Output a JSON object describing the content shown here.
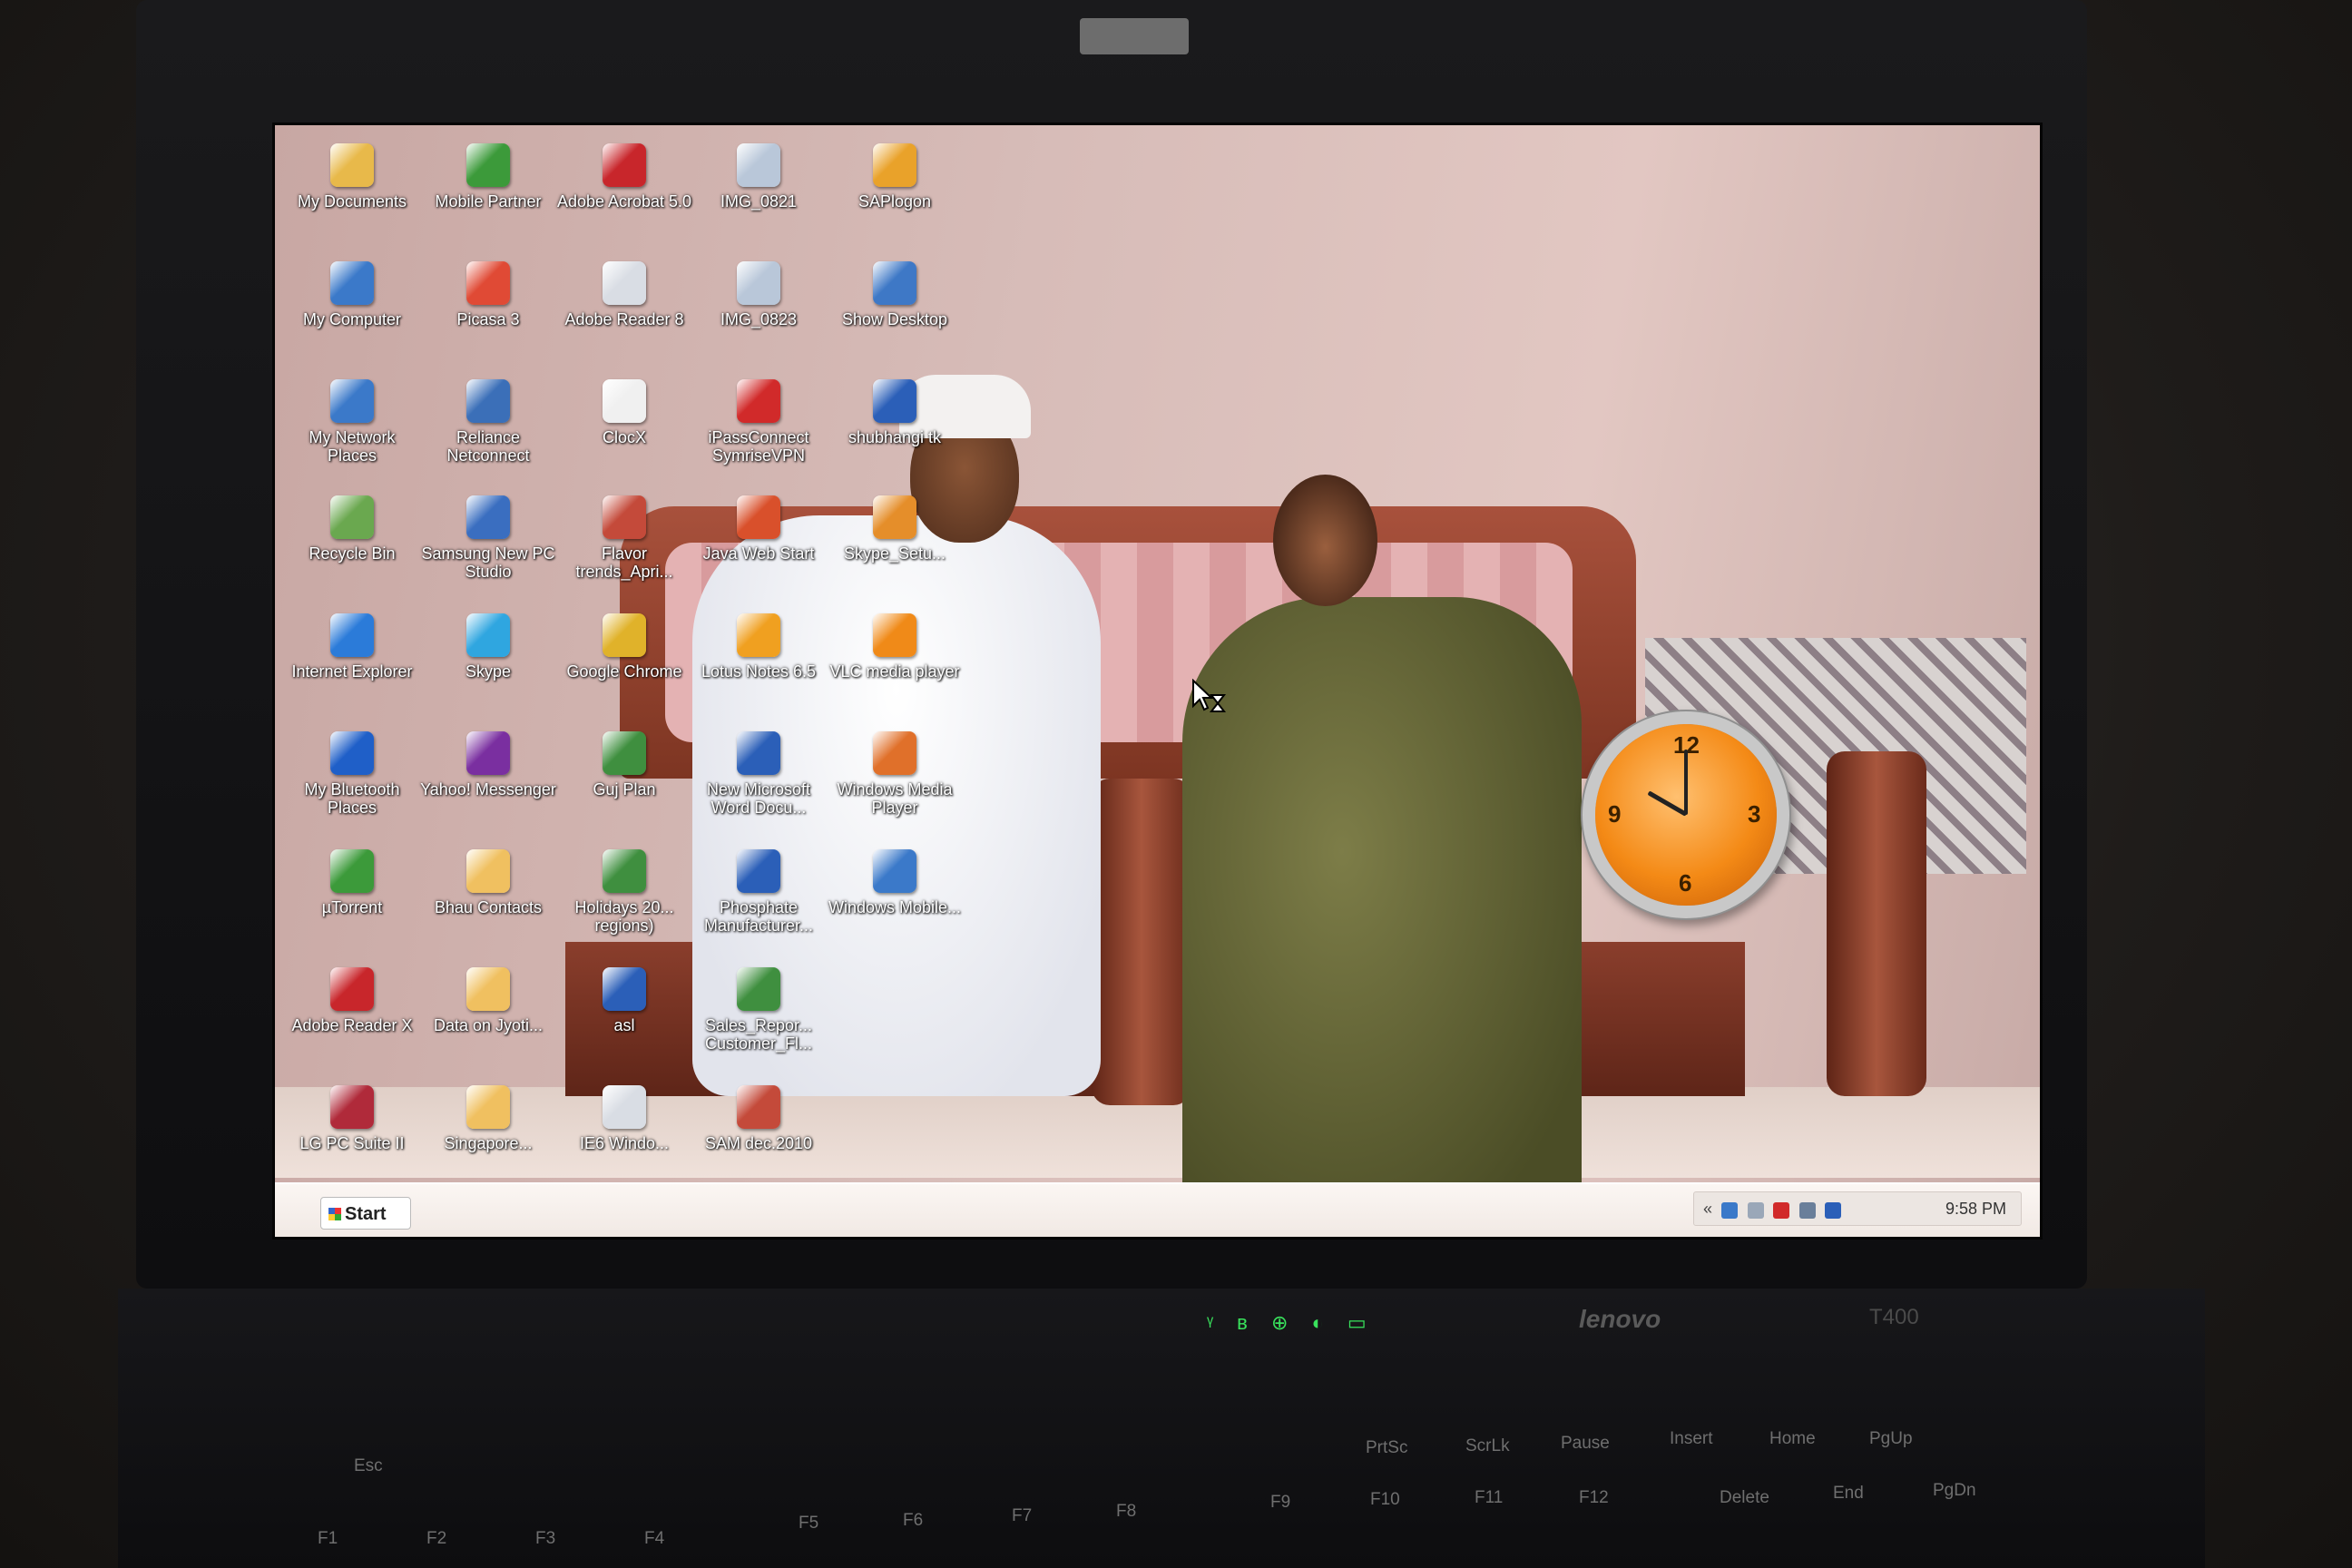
{
  "desktop": {
    "icons": [
      {
        "label": "My Documents",
        "color": "#e8b94a"
      },
      {
        "label": "Mobile Partner",
        "color": "#3c9a3a"
      },
      {
        "label": "Adobe Acrobat 5.0",
        "color": "#c8262b"
      },
      {
        "label": "IMG_0821",
        "color": "#b9c7d9"
      },
      {
        "label": "SAPlogon",
        "color": "#e9a22a"
      },
      {
        "label": "My Computer",
        "color": "#3b79c9"
      },
      {
        "label": "Picasa 3",
        "color": "#e04a35"
      },
      {
        "label": "Adobe Reader 8",
        "color": "#d9dde4"
      },
      {
        "label": "IMG_0823",
        "color": "#b9c7d9"
      },
      {
        "label": "Show Desktop",
        "color": "#3e78c6"
      },
      {
        "label": "My Network Places",
        "color": "#3b79c9"
      },
      {
        "label": "Reliance Netconnect",
        "color": "#3b6fb8"
      },
      {
        "label": "ClocX",
        "color": "#f0f0f0"
      },
      {
        "label": "iPassConnect SymriseVPN",
        "color": "#d12a2a"
      },
      {
        "label": "shubhangi tk",
        "color": "#2b5fb8"
      },
      {
        "label": "Recycle Bin",
        "color": "#6aa84f"
      },
      {
        "label": "Samsung New PC Studio",
        "color": "#3a6ec0"
      },
      {
        "label": "Flavor trends_Apri...",
        "color": "#c44a3a"
      },
      {
        "label": "Java Web Start",
        "color": "#d9502b"
      },
      {
        "label": "Skype_Setu...",
        "color": "#e58e2a"
      },
      {
        "label": "Internet Explorer",
        "color": "#2b7bd9"
      },
      {
        "label": "Skype",
        "color": "#2fa6e0"
      },
      {
        "label": "Google Chrome",
        "color": "#e0b22a"
      },
      {
        "label": "Lotus Notes 6.5",
        "color": "#f0a020"
      },
      {
        "label": "VLC media player",
        "color": "#f08a18"
      },
      {
        "label": "My Bluetooth Places",
        "color": "#1f5fc8"
      },
      {
        "label": "Yahoo! Messenger",
        "color": "#7a2fa0"
      },
      {
        "label": "Guj Plan",
        "color": "#3f8f3f"
      },
      {
        "label": "New Microsoft Word Docu...",
        "color": "#2b5fb8"
      },
      {
        "label": "Windows Media Player",
        "color": "#e0702a"
      },
      {
        "label": "µTorrent",
        "color": "#3c9a3a"
      },
      {
        "label": "Bhau Contacts",
        "color": "#f0c060"
      },
      {
        "label": "Holidays 20... regions)",
        "color": "#3f8f3f"
      },
      {
        "label": "Phosphate Manufacturer...",
        "color": "#2b5fb8"
      },
      {
        "label": "Windows Mobile...",
        "color": "#3b79c9"
      },
      {
        "label": "Adobe Reader X",
        "color": "#c8262b"
      },
      {
        "label": "Data on Jyoti...",
        "color": "#f0c060"
      },
      {
        "label": "asl",
        "color": "#2b5fb8"
      },
      {
        "label": "Sales_Repor... Customer_Fl...",
        "color": "#3f8f3f"
      },
      {
        "label": "LG PC Suite II",
        "color": "#b02a3a"
      },
      {
        "label": "Singapore...",
        "color": "#f0c060"
      },
      {
        "label": "IE6 Windo...",
        "color": "#d9dde4"
      },
      {
        "label": "SAM dec.2010",
        "color": "#c44a3a"
      }
    ]
  },
  "clock_gadget": {
    "numbers": [
      "12",
      "3",
      "6",
      "9"
    ],
    "hour": 10,
    "minute": 0
  },
  "taskbar": {
    "start_label": "Start",
    "time": "9:58 PM",
    "chevron": "«"
  },
  "laptop": {
    "brand": "lenovo",
    "model": "T400",
    "leds": "ᵞ ʙ ⊕ ◐ ▭",
    "keys": [
      "Esc",
      "F1",
      "F2",
      "F3",
      "F4",
      "F5",
      "F6",
      "F7",
      "F8",
      "F9",
      "F10",
      "F11",
      "F12",
      "PrtSc",
      "ScrLk",
      "Pause",
      "Insert",
      "Home",
      "PgUp",
      "Delete",
      "End",
      "PgDn"
    ]
  }
}
